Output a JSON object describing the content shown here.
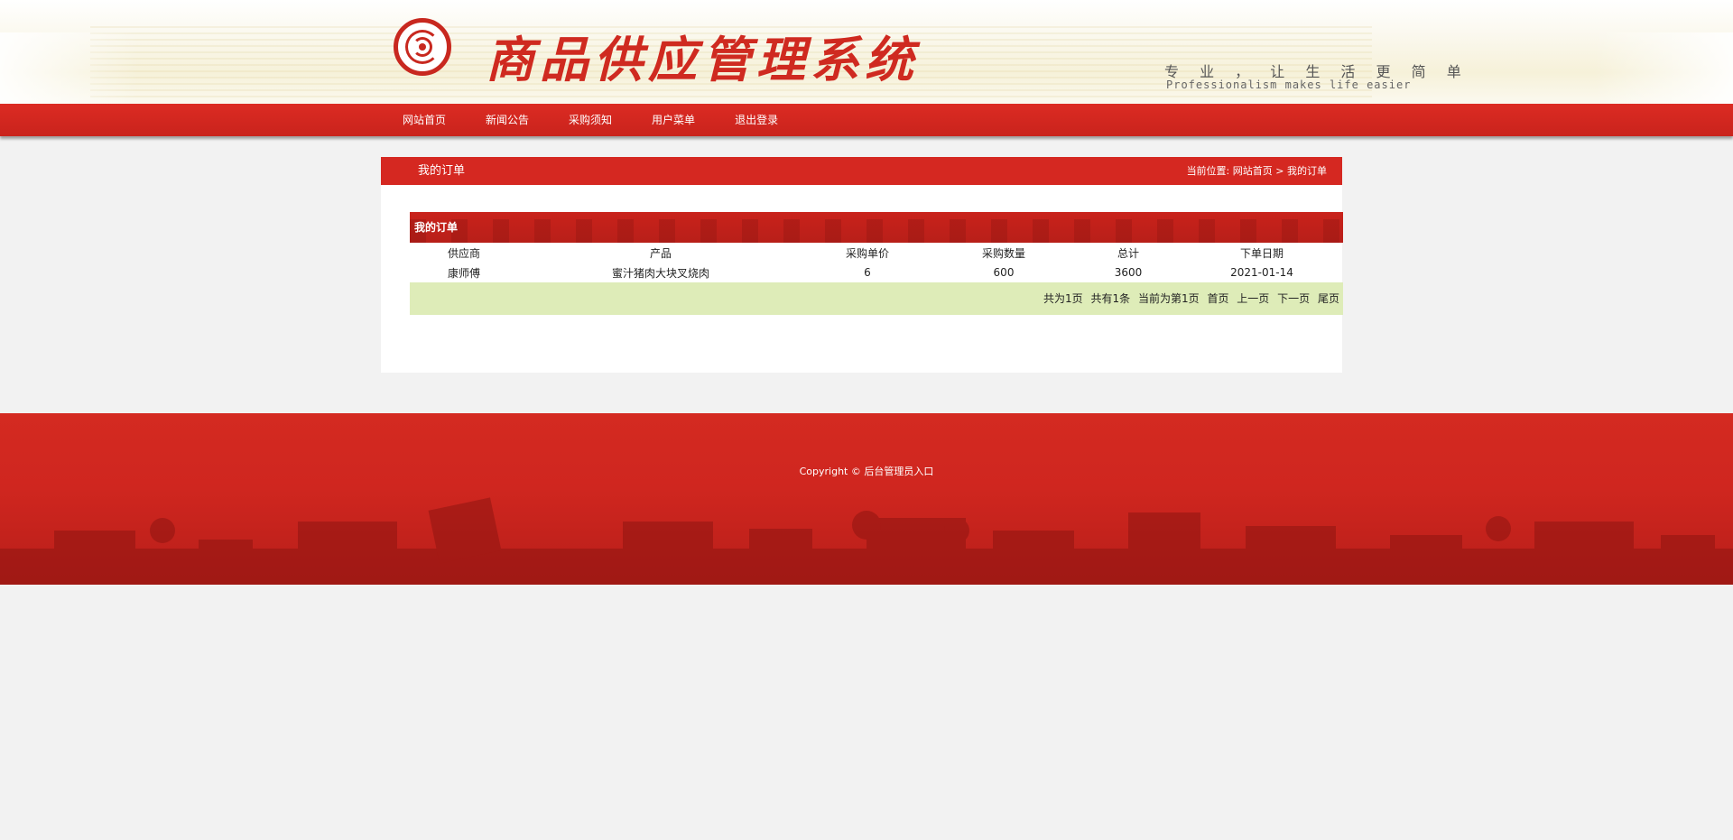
{
  "header": {
    "title": "商品供应管理系统",
    "slogan_cn": "专 业 ， 让 生 活 更 简 单",
    "slogan_en": "Professionalism makes life easier"
  },
  "nav": [
    "网站首页",
    "新闻公告",
    "采购须知",
    "用户菜单",
    "退出登录"
  ],
  "panel": {
    "title": "我的订单",
    "breadcrumb": {
      "prefix": "当前位置:",
      "home": "网站首页",
      "separator": ">",
      "current": "我的订单"
    }
  },
  "orders": {
    "title": "我的订单",
    "columns": [
      "供应商",
      "产品",
      "采购单价",
      "采购数量",
      "总计",
      "下单日期"
    ],
    "rows": [
      [
        "康师傅",
        "蜜汁猪肉大块叉烧肉",
        "6",
        "600",
        "3600",
        "2021-01-14"
      ]
    ]
  },
  "pager": {
    "total_pages": "共为1页",
    "total_items": "共有1条",
    "current_page": "当前为第1页",
    "first": "首页",
    "prev": "上一页",
    "next": "下一页",
    "last": "尾页"
  },
  "footer": {
    "copyright": "Copyright ©",
    "admin_link": "后台管理员入口"
  },
  "colors": {
    "brand_red": "#d52821",
    "pager_bg": "#deecb8",
    "page_bg": "#f2f2f2"
  }
}
